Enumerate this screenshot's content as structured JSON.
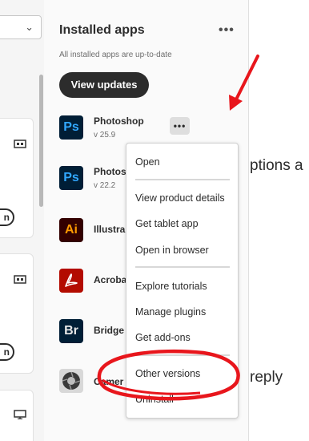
{
  "installed_apps": {
    "title": "Installed apps",
    "more_icon": "more-icon",
    "status": "All installed apps are up-to-date",
    "view_updates_label": "View updates",
    "apps": [
      {
        "name": "Photoshop",
        "version": "v 25.9",
        "logo_text": "Ps"
      },
      {
        "name": "Photos",
        "version": "v 22.2",
        "logo_text": "Ps"
      },
      {
        "name": "Illustra",
        "version": "",
        "logo_text": "Ai"
      },
      {
        "name": "Acroba",
        "version": "",
        "logo_text": ""
      },
      {
        "name": "Bridge",
        "version": "",
        "logo_text": "Br"
      },
      {
        "name": "Camer",
        "version": "",
        "logo_text": ""
      }
    ]
  },
  "context_menu": {
    "items": [
      "Open",
      "View product details",
      "Get tablet app",
      "Open in browser",
      "Explore tutorials",
      "Manage plugins",
      "Get add-ons",
      "Other versions",
      "Uninstall"
    ]
  },
  "right_area": {
    "options_text": "ptions a",
    "reply_text": "reply"
  },
  "left_area": {
    "button_fragment": "n"
  },
  "annotation_color": "#e8161c"
}
